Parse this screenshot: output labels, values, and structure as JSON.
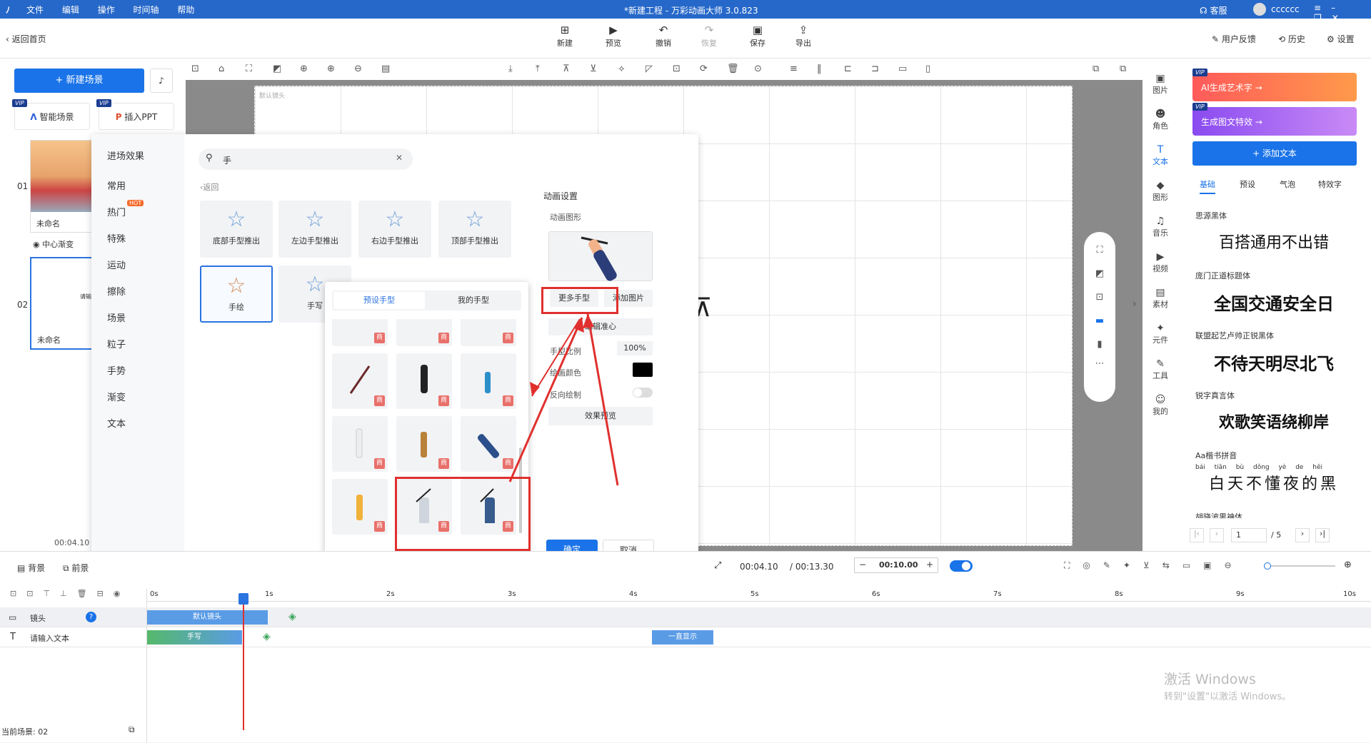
{
  "titlebar": {
    "menu": [
      "文件",
      "编辑",
      "操作",
      "时间轴",
      "帮助"
    ],
    "title": "*新建工程 - 万彩动画大师 3.0.823",
    "service": "客服",
    "user": "cccccc"
  },
  "toolbar": {
    "back": "返回首页",
    "new": "新建",
    "preview": "预览",
    "undo": "撤销",
    "redo": "恢复",
    "save": "保存",
    "export": "导出",
    "feedback": "用户反馈",
    "history": "历史",
    "settings": "设置"
  },
  "left": {
    "new_scene": "+ 新建场景",
    "vip": "VIP",
    "smart_scene": "智能场景",
    "insert_ppt": "插入PPT",
    "scene1_num": "01",
    "scene1_name": "未命名",
    "transition": "中心渐变",
    "scene2_num": "02",
    "scene2_name": "未命名",
    "scene2_text": "请输",
    "time": "00:04.10"
  },
  "dialog": {
    "title": "进场效果",
    "categories": [
      "常用",
      "热门",
      "特殊",
      "运动",
      "擦除",
      "场景",
      "粒子",
      "手势",
      "渐变",
      "文本"
    ],
    "hot": "HOT",
    "search_value": "手",
    "back": "返回",
    "tiles": [
      "底部手型推出",
      "左边手型推出",
      "右边手型推出",
      "顶部手型推出",
      "手绘",
      "手写"
    ],
    "settings_title": "动画设置",
    "shape_label": "动画图形",
    "more_hands": "更多手型",
    "add_image": "添加图片",
    "edit_center": "编辑准心",
    "scale_label": "手型比例",
    "scale_value": "100%",
    "color_label": "绘画颜色",
    "reverse_label": "反向绘制",
    "effect_preview": "效果预览",
    "ok": "确定",
    "cancel": "取消",
    "canvas_tag": "默认镜头"
  },
  "popup": {
    "tab_preset": "预设手型",
    "tab_mine": "我的手型",
    "badge": "商"
  },
  "rail": [
    "图片",
    "角色",
    "文本",
    "图形",
    "音乐",
    "视频",
    "素材",
    "元件",
    "工具",
    "我的"
  ],
  "right": {
    "ai_art": "AI生成艺术字 →",
    "gen_text": "生成图文特效 →",
    "add_text": "+ 添加文本",
    "tabs": [
      "基础",
      "预设",
      "气泡",
      "特效字"
    ],
    "fonts": [
      {
        "name": "思源黑体",
        "demo": "百搭通用不出错"
      },
      {
        "name": "庞门正道标题体",
        "demo": "全国交通安全日"
      },
      {
        "name": "联盟起艺卢帅正锐黑体",
        "demo": "不待天明尽北飞"
      },
      {
        "name": "锐字真言体",
        "demo": "欢歌笑语绕柳岸"
      },
      {
        "name": "Aa楷书拼音",
        "demo": "白天不懂夜的黑",
        "pinyin": "bái tiān bù dǒng yè de hēi"
      },
      {
        "name": "胡晓波男神体"
      }
    ],
    "page": "1",
    "page_total": "/ 5"
  },
  "timeline": {
    "bg": "背景",
    "fg": "前景",
    "current": "00:04.10",
    "total": "/ 00:13.30",
    "duration": "00:10.00",
    "ruler": [
      "0s",
      "1s",
      "2s",
      "3s",
      "4s",
      "5s",
      "6s",
      "7s",
      "8s",
      "9s",
      "10s"
    ],
    "track1": "镜头",
    "track2": "请输入文本",
    "clip1": "默认镜头",
    "clip2": "手写",
    "clip3": "一直显示",
    "status": "当前场景: 02",
    "watermark1": "激活 Windows",
    "watermark2": "转到\"设置\"以激活 Windows。"
  }
}
